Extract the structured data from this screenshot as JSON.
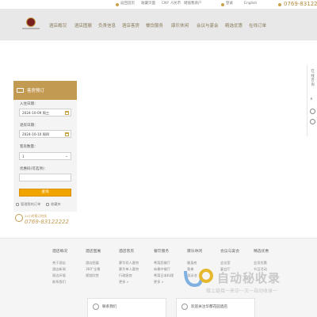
{
  "topbar": {
    "links": [
      "返回首页",
      "收藏页面",
      "CNY 人民币",
      "储值我商户",
      "登录",
      "English"
    ],
    "phone": "0769-83122222"
  },
  "nav": {
    "items": [
      "酒店概况",
      "酒店图展",
      "负责信息",
      "酒店客房",
      "餐饮服务",
      "康乐休闲",
      "会议与宴会",
      "精选优惠",
      "在线订单"
    ]
  },
  "booking": {
    "title": "客房预订",
    "checkin_label": "入住日期：",
    "checkin_value": "2024-10-09 周三",
    "checkout_label": "退房日期：",
    "checkout_value": "2024-10-10 周四",
    "rooms_label": "客房数量：",
    "rooms_value": "1",
    "promo_label": "优惠码(可选项)：",
    "promo_placeholder": "",
    "search_label": "查询",
    "link_manage": "管理我的订单",
    "link_favorites": "收藏夹"
  },
  "hotline": {
    "label": "24小时预订热线",
    "number": "0769-83122222"
  },
  "sidebar": {
    "vertical_text": "在线咨询",
    "up_label": "∧"
  },
  "footer": {
    "columns": [
      {
        "heading": "酒店概况",
        "items": [
          "关于酒店",
          "酒店新闻",
          "周边环境",
          "联系我们"
        ]
      },
      {
        "heading": "酒店图展",
        "items": [
          "酒店图展",
          "360°全景",
          "视频欣赏"
        ]
      },
      {
        "heading": "酒店客房",
        "items": [
          "豪华双人客房",
          "豪华单人客房",
          "行政客房",
          "更多 »"
        ]
      },
      {
        "heading": "餐饮服务",
        "items": [
          "粤菜西餐厅",
          "咏春中餐厅",
          "粤菜日本料理",
          "更多 »"
        ]
      },
      {
        "heading": "康乐休闲",
        "items": [
          "健身房",
          "桑拿",
          "游泳池"
        ]
      },
      {
        "heading": "会议与宴会",
        "items": [
          "会议室",
          "宴会厅"
        ]
      },
      {
        "heading": "精选优惠",
        "items": [
          "会员优惠",
          "节日活动"
        ]
      }
    ],
    "contact_box": "联系我们",
    "wechat_box": "欢迎关注华都花园酒店"
  },
  "watermark": {
    "main": "自动秘收录",
    "sub": "做上链接一来访一次一自动收录一"
  },
  "colors": {
    "accent": "#c39a52",
    "button": "#f0a400",
    "header_bg": "#e8e8e8"
  }
}
